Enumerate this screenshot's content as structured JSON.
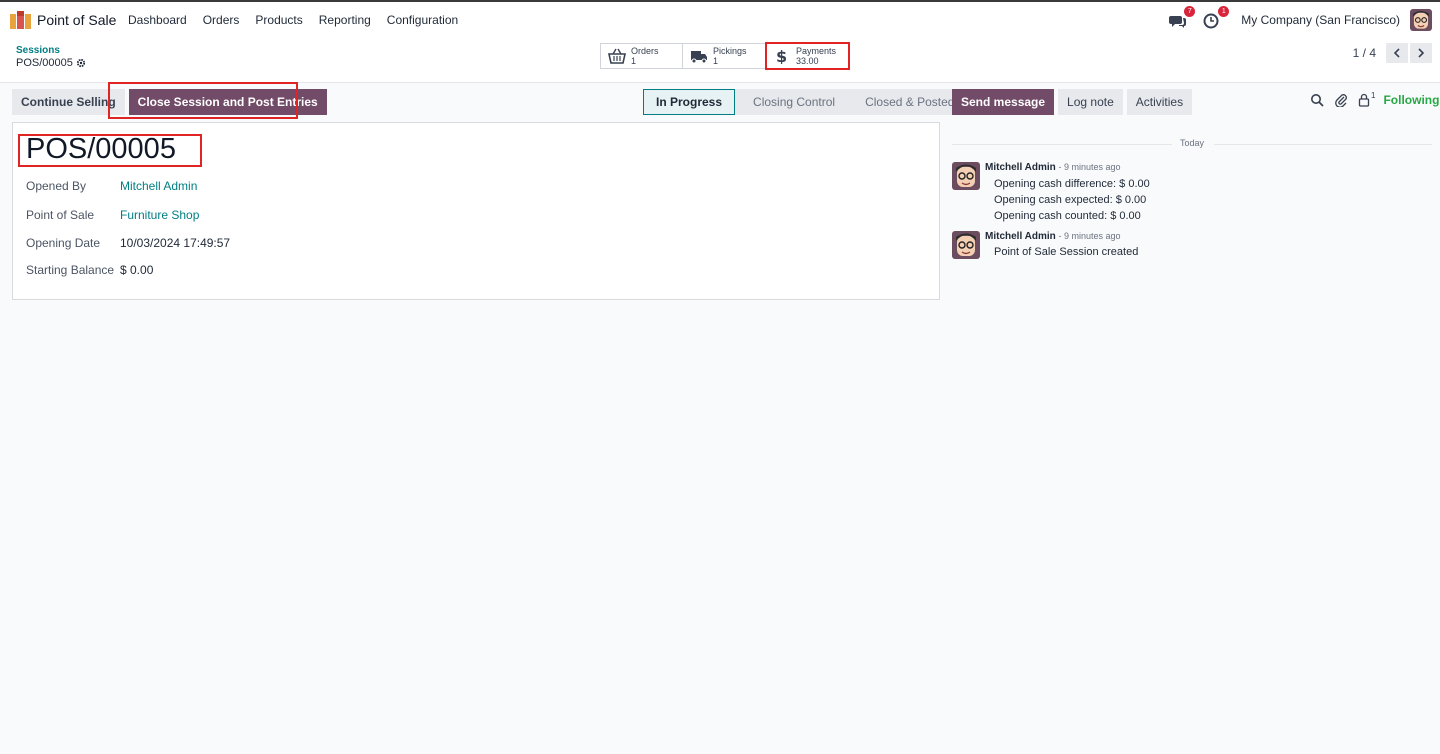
{
  "navbar": {
    "app_name": "Point of Sale",
    "menu": [
      "Dashboard",
      "Orders",
      "Products",
      "Reporting",
      "Configuration"
    ],
    "messages_badge": "7",
    "activities_badge": "1",
    "company": "My Company (San Francisco)"
  },
  "breadcrumb": {
    "parent": "Sessions",
    "current": "POS/00005"
  },
  "smart_buttons": {
    "orders": {
      "label": "Orders",
      "value": "1"
    },
    "pickings": {
      "label": "Pickings",
      "value": "1"
    },
    "payments": {
      "label": "Payments",
      "value": "33.00"
    }
  },
  "pager": {
    "value": "1 / 4"
  },
  "actions": {
    "continue_selling": "Continue Selling",
    "close_session": "Close Session and Post Entries"
  },
  "statusbar": [
    "In Progress",
    "Closing Control",
    "Closed & Posted"
  ],
  "chatter_actions": {
    "send_message": "Send message",
    "log_note": "Log note",
    "activities": "Activities",
    "followers_count": "1",
    "following": "Following"
  },
  "form": {
    "title": "POS/00005",
    "fields": [
      {
        "label": "Opened By",
        "value": "Mitchell Admin"
      },
      {
        "label": "Point of Sale",
        "value": "Furniture Shop"
      },
      {
        "label": "Opening Date",
        "value": "10/03/2024 17:49:57"
      },
      {
        "label": "Starting Balance",
        "value": "$ 0.00"
      }
    ]
  },
  "chatter": {
    "date_separator": "Today",
    "messages": [
      {
        "author": "Mitchell Admin",
        "time": "- 9 minutes ago",
        "lines": [
          "Opening cash difference: $ 0.00",
          "Opening cash expected: $ 0.00",
          "Opening cash counted: $ 0.00"
        ]
      },
      {
        "author": "Mitchell Admin",
        "time": "- 9 minutes ago",
        "lines": [
          "Point of Sale Session created"
        ]
      }
    ]
  },
  "colors": {
    "brand": "#714b67",
    "link": "#017e84",
    "highlight": "#e02424",
    "following": "#28a745"
  }
}
